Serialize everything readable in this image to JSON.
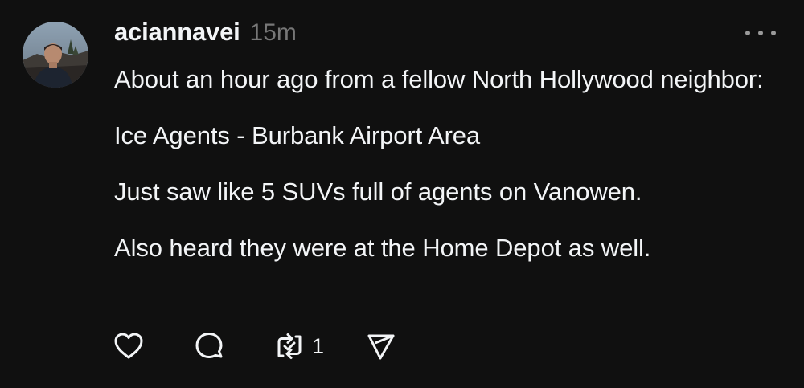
{
  "post": {
    "avatar_icon": "profile-photo",
    "username": "aciannavei",
    "timestamp": "15m",
    "more_icon": "more-horizontal-icon",
    "paragraphs": [
      "About an hour ago from a fellow North Hollywood neighbor:",
      "Ice Agents - Burbank Airport Area",
      "Just saw like 5 SUVs full of agents on Vanowen.",
      "Also heard they were at the Home Depot as well."
    ],
    "actions": {
      "like_icon": "heart-icon",
      "reply_icon": "comment-icon",
      "repost_icon": "repost-icon",
      "repost_count": "1",
      "share_icon": "send-icon"
    }
  },
  "colors": {
    "background": "#101010",
    "text": "#f3f5f7",
    "muted": "#777777"
  }
}
